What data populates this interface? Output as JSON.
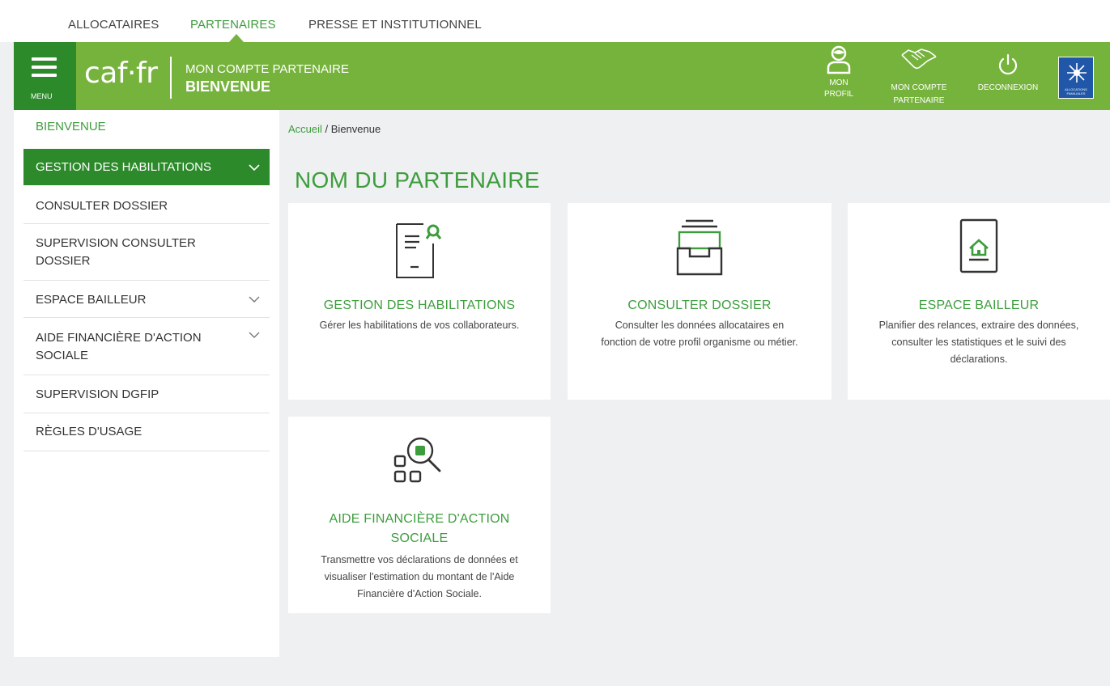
{
  "top_nav": {
    "items": [
      {
        "label": "ALLOCATAIRES"
      },
      {
        "label": "PARTENAIRES"
      },
      {
        "label": "PRESSE ET INSTITUTIONNEL"
      }
    ],
    "active": "PARTENAIRES"
  },
  "header": {
    "menu_label": "MENU",
    "logo_text": "caf·fr",
    "subtitle": "MON COMPTE PARTENAIRE",
    "title": "BIENVENUE",
    "actions": [
      {
        "line1": "MON",
        "line2": "PROFIL",
        "icon": "user-icon"
      },
      {
        "line1": "MON COMPTE",
        "line2": "PARTENAIRE",
        "icon": "handshake-icon"
      },
      {
        "line1": "DECONNEXION",
        "line2": "",
        "icon": "power-icon"
      }
    ],
    "emblem_caption": "ALLOCATIONS FAMILIALES",
    "colors": {
      "header_green": "#76b33c",
      "dark_green": "#2c8a2a",
      "text_green": "#3d9d3d"
    }
  },
  "sidebar": {
    "home": "BIENVENUE",
    "items": [
      {
        "label": "GESTION DES HABILITATIONS",
        "expandable": true,
        "active": true
      },
      {
        "label": "CONSULTER DOSSIER",
        "expandable": false
      },
      {
        "label_line1": "SUPERVISION CONSULTER",
        "label_line2": "DOSSIER",
        "expandable": false
      },
      {
        "label": "ESPACE BAILLEUR",
        "expandable": true
      },
      {
        "label_line1": "AIDE FINANCIÈRE D'ACTION",
        "label_line2": "SOCIALE",
        "expandable": true
      },
      {
        "label": "SUPERVISION DGFIP",
        "expandable": false
      },
      {
        "label": "RÈGLES D'USAGE",
        "expandable": false
      }
    ]
  },
  "breadcrumb": {
    "home": "Accueil",
    "separator": " / ",
    "current": "Bienvenue"
  },
  "main": {
    "title": "NOM DU PARTENAIRE",
    "cards": [
      {
        "title": "GESTION DES HABILITATIONS",
        "desc": [
          "Gérer les habilitations de vos collaborateurs."
        ],
        "icon": "document-badge-icon"
      },
      {
        "title": "CONSULTER DOSSIER",
        "desc": [
          "Consulter les données allocataires en",
          "fonction de votre profil organisme ou métier."
        ],
        "icon": "archive-box-icon"
      },
      {
        "title": "ESPACE BAILLEUR",
        "desc": [
          "Planifier des relances, extraire des données,",
          "consulter les statistiques et le suivi des",
          "déclarations."
        ],
        "icon": "tablet-house-icon"
      },
      {
        "title_line1": "AIDE FINANCIÈRE D'ACTION",
        "title_line2": "SOCIALE",
        "desc": [
          "Transmettre vos déclarations de données et",
          "visualiser l'estimation du montant de l'Aide",
          "Financière d'Action Sociale."
        ],
        "icon": "grid-search-icon"
      }
    ]
  }
}
